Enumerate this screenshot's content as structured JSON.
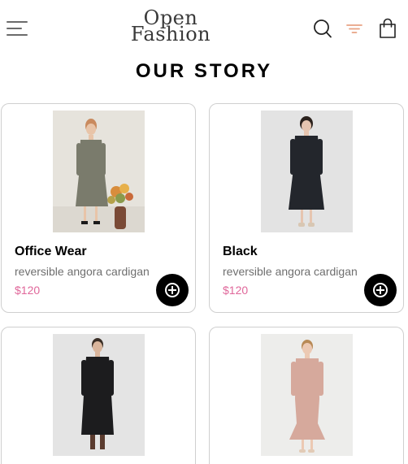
{
  "header": {
    "logo_line1": "Open",
    "logo_line2": "Fashion",
    "accent_color": "#e8a384"
  },
  "icons": {
    "menu": "hamburger-menu-icon",
    "search": "search-icon",
    "filter": "filter-icon",
    "bag": "shopping-bag-icon",
    "add": "plus-circle-icon"
  },
  "section": {
    "title": "OUR STORY"
  },
  "products": [
    {
      "name": "Office Wear",
      "description": "reversible angora cardigan",
      "price": "$120",
      "dress_color": "#7a7b6c"
    },
    {
      "name": "Black",
      "description": "reversible angora cardigan",
      "price": "$120",
      "dress_color": "#23262c"
    },
    {
      "name": "",
      "description": "",
      "price": "",
      "dress_color": "#1c1c1e"
    },
    {
      "name": "",
      "description": "",
      "price": "",
      "dress_color": "#d6a99c"
    }
  ],
  "colors": {
    "price": "#e0679a",
    "add_button": "#000000",
    "card_border": "#cfcfcf"
  }
}
